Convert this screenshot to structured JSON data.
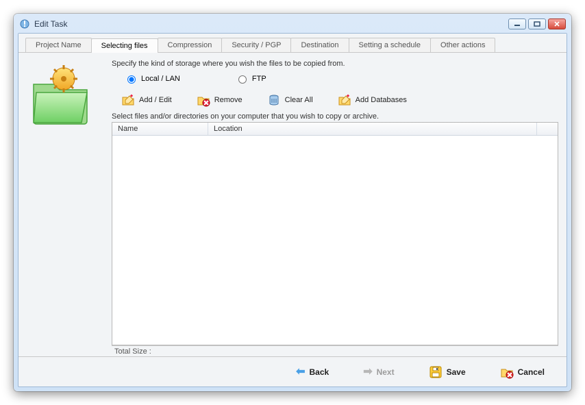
{
  "window": {
    "title": "Edit Task"
  },
  "tabs": [
    "Project Name",
    "Selecting files",
    "Compression",
    "Security / PGP",
    "Destination",
    "Setting a schedule",
    "Other actions"
  ],
  "active_tab_index": 1,
  "page": {
    "instruction": "Specify the kind of storage where you wish the files to be copied from.",
    "radio_local": "Local / LAN",
    "radio_ftp": "FTP",
    "radio_selected": "local"
  },
  "toolbar": {
    "add_edit": "Add / Edit",
    "remove": "Remove",
    "clear_all": "Clear All",
    "add_databases": "Add Databases"
  },
  "list": {
    "hint": "Select files and/or directories on your computer that you wish to copy or archive.",
    "columns": {
      "name": "Name",
      "location": "Location"
    },
    "rows": []
  },
  "total_label": "Total Size :",
  "footer": {
    "back": "Back",
    "next": "Next",
    "save": "Save",
    "cancel": "Cancel",
    "next_enabled": false
  }
}
